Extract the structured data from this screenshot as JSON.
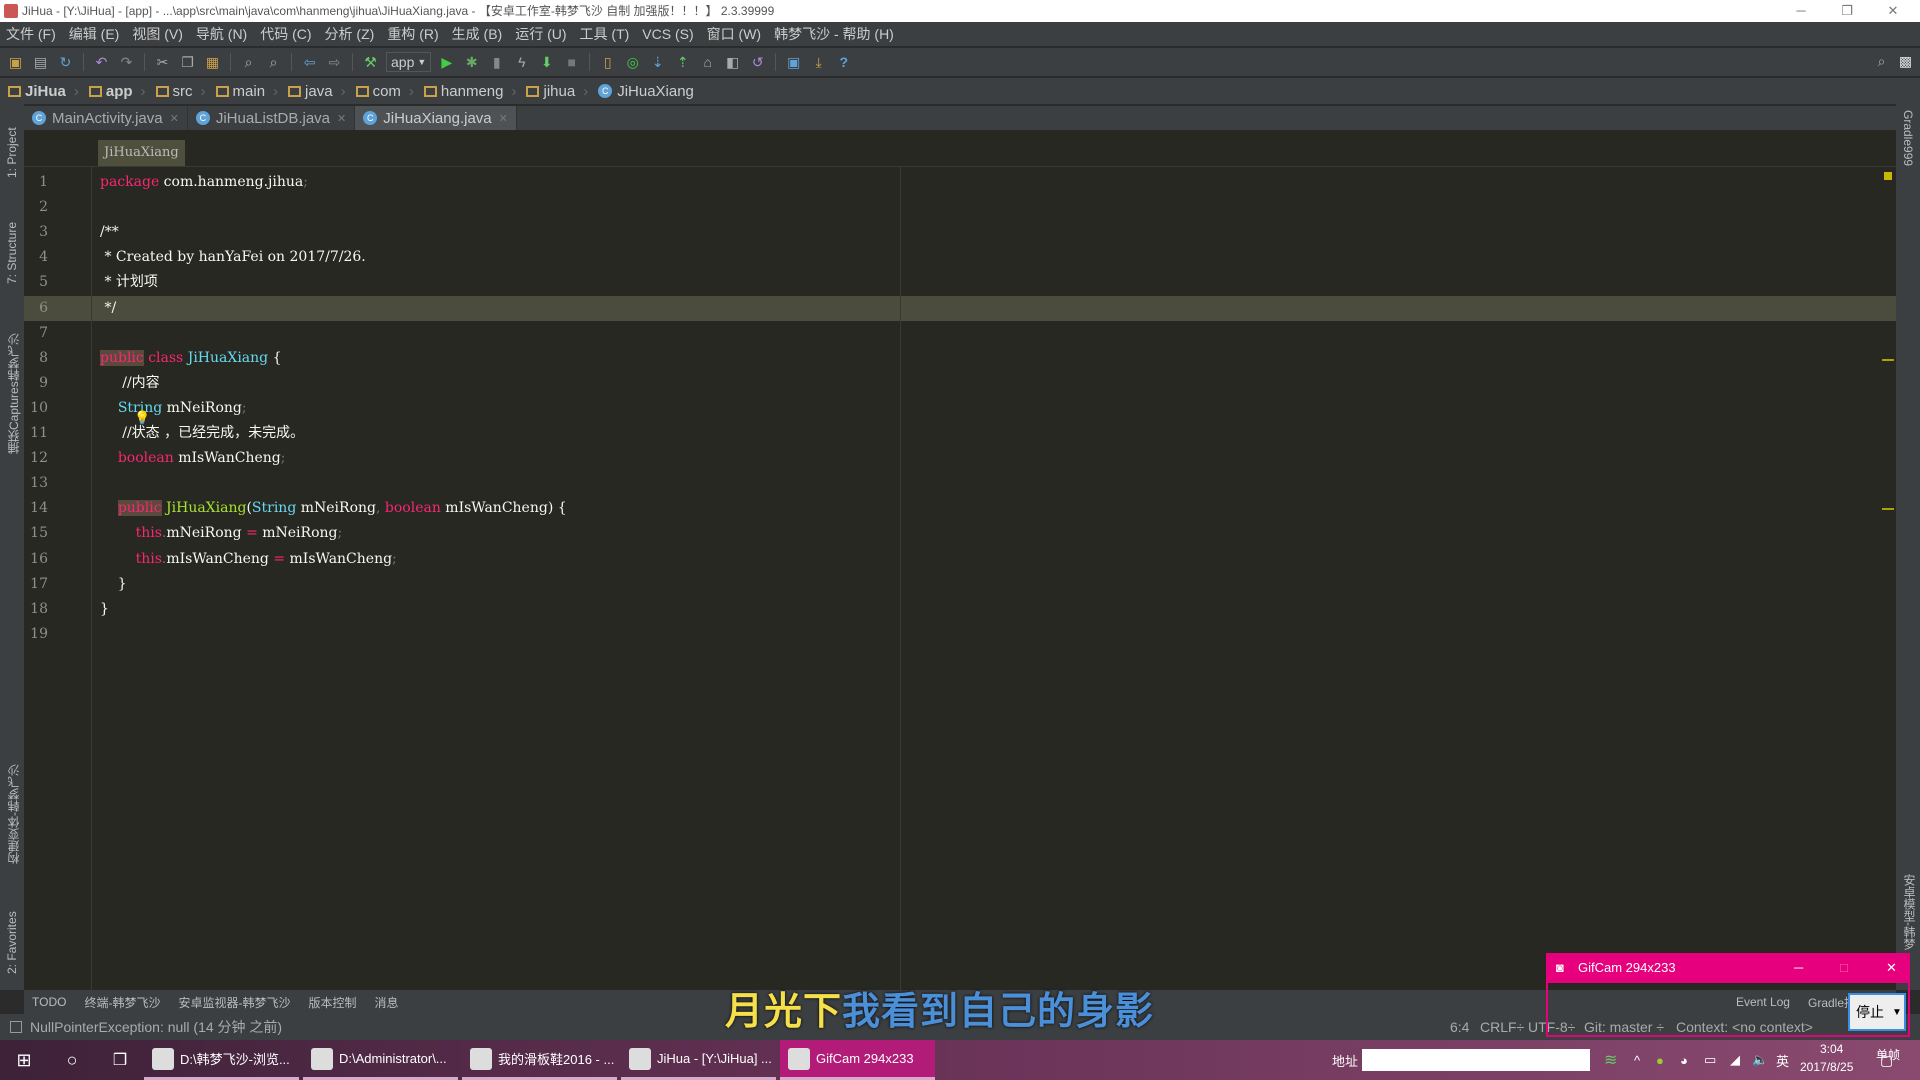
{
  "window": {
    "title": "JiHua - [Y:\\JiHua] - [app] - ...\\app\\src\\main\\java\\com\\hanmeng\\jihua\\JiHuaXiang.java - 【安卓工作室-韩梦飞沙 自制 加强版！！！】 2.3.39999",
    "min": "─",
    "max": "❐",
    "close": "✕"
  },
  "menu": [
    "文件 (F)",
    "编辑 (E)",
    "视图 (V)",
    "导航 (N)",
    "代码 (C)",
    "分析 (Z)",
    "重构 (R)",
    "生成 (B)",
    "运行 (U)",
    "工具 (T)",
    "VCS (S)",
    "窗口 (W)",
    "韩梦飞沙 - 帮助 (H)"
  ],
  "toolbar": {
    "run_config": "app",
    "help": "?"
  },
  "breadcrumb": [
    "JiHua",
    "app",
    "src",
    "main",
    "java",
    "com",
    "hanmeng",
    "jihua",
    "JiHuaXiang"
  ],
  "tabs": [
    {
      "label": "MainActivity.java"
    },
    {
      "label": "JiHuaListDB.java"
    },
    {
      "label": "JiHuaXiang.java",
      "active": true
    }
  ],
  "left_tools": [
    "1: Project",
    "7: Structure",
    "捕获Captures韩梦飞沙",
    "构建变体-韩梦飞沙",
    "2: Favorites"
  ],
  "right_tools": [
    "Gradle999",
    "安卓模型-韩梦"
  ],
  "editor": {
    "crumb": "JiHuaXiang",
    "highlighted_line": 6,
    "lines": [
      [
        [
          "k",
          "package"
        ],
        [
          "c",
          " com.hanmeng.jihua"
        ],
        [
          "p",
          ";"
        ]
      ],
      [],
      [
        [
          "c",
          "/**"
        ]
      ],
      [
        [
          "c",
          " * Created by hanYaFei on 2017/7/26."
        ]
      ],
      [
        [
          "c",
          " * 计划项"
        ]
      ],
      [
        [
          "c",
          " */"
        ]
      ],
      [],
      [
        [
          "pub",
          "public"
        ],
        [
          "c",
          " "
        ],
        [
          "k",
          "class"
        ],
        [
          "c",
          " "
        ],
        [
          "t",
          "JiHuaXiang"
        ],
        [
          "c",
          " {"
        ]
      ],
      [
        [
          "c",
          "     //内容"
        ]
      ],
      [
        [
          "c",
          "    "
        ],
        [
          "t",
          "String"
        ],
        [
          "c",
          " mNeiRong"
        ],
        [
          "p",
          ";"
        ]
      ],
      [
        [
          "c",
          "     //状态 ，已经完成，未完成。"
        ]
      ],
      [
        [
          "c",
          "    "
        ],
        [
          "k",
          "boolean"
        ],
        [
          "c",
          " mIsWanCheng"
        ],
        [
          "p",
          ";"
        ]
      ],
      [],
      [
        [
          "c",
          "    "
        ],
        [
          "pub",
          "public"
        ],
        [
          "c",
          " "
        ],
        [
          "f",
          "JiHuaXiang"
        ],
        [
          "c",
          "("
        ],
        [
          "t",
          "String"
        ],
        [
          "c",
          " mNeiRong"
        ],
        [
          "p",
          ", "
        ],
        [
          "k",
          "boolean"
        ],
        [
          "c",
          " mIsWanCheng) {"
        ]
      ],
      [
        [
          "c",
          "        "
        ],
        [
          "k",
          "this"
        ],
        [
          "p",
          "."
        ],
        [
          "c",
          "mNeiRong "
        ],
        [
          "k",
          "="
        ],
        [
          "c",
          " mNeiRong"
        ],
        [
          "p",
          ";"
        ]
      ],
      [
        [
          "c",
          "        "
        ],
        [
          "k",
          "this"
        ],
        [
          "p",
          "."
        ],
        [
          "c",
          "mIsWanCheng "
        ],
        [
          "k",
          "="
        ],
        [
          "c",
          " mIsWanCheng"
        ],
        [
          "p",
          ";"
        ]
      ],
      [
        [
          "c",
          "    }"
        ]
      ],
      [
        [
          "c",
          "}"
        ]
      ],
      []
    ]
  },
  "bottom_tools": [
    "TODO",
    "终端-韩梦飞沙",
    "安卓监视器-韩梦飞沙",
    "版本控制",
    "消息",
    "Event Log",
    "Gradle控制台-韩"
  ],
  "status": {
    "message": "NullPointerException: null (14 分钟 之前)",
    "position": "6:4",
    "line_sep": "CRLF÷",
    "encoding": "UTF-8÷",
    "git": "Git: master ÷",
    "context": "Context: <no context>"
  },
  "subtitle": {
    "part1": "月光下",
    "part2": "我看到自己的身影",
    "color1": "#f5e04a",
    "color2": "#4a8fd8"
  },
  "gifcam": {
    "title": "GifCam 294x233",
    "stop": "停止",
    "single": "单帧"
  },
  "taskbar": {
    "tasks": [
      "D:\\韩梦飞沙-浏览...",
      "D:\\Administrator\\...",
      "我的滑板鞋2016 - ...",
      "JiHua - [Y:\\JiHua] ...",
      "GifCam 294x233"
    ],
    "address_label": "地址",
    "ime": "英",
    "time": "3:04",
    "date": "2017/8/25"
  }
}
